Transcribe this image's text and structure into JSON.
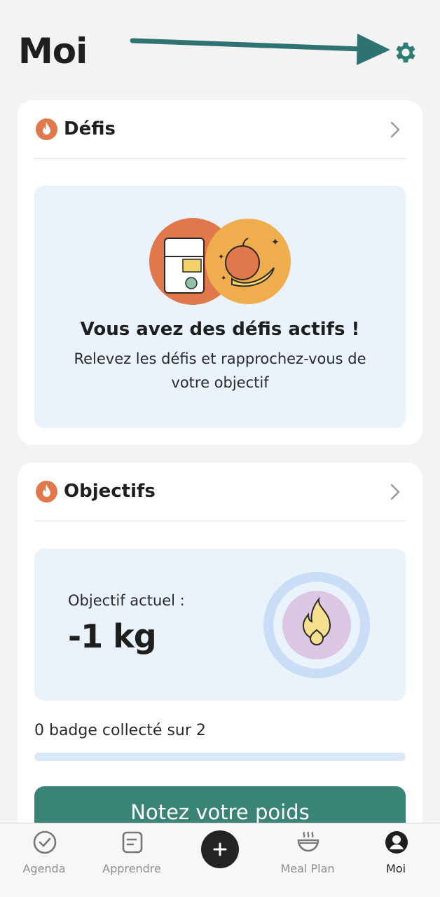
{
  "page": {
    "title": "Moi"
  },
  "icons": {
    "settings": "gear-icon",
    "annotation": "arrow-pointer"
  },
  "colors": {
    "accent": "#3a8477",
    "flame": "#e0784b",
    "panel": "#eaf2fc",
    "arrow": "#2e7372"
  },
  "defis_card": {
    "title": "Défis",
    "panel_title": "Vous avez des défis actifs !",
    "panel_subtitle": "Relevez les défis et rapprochez-vous de votre objectif"
  },
  "objectifs_card": {
    "title": "Objectifs",
    "current_label": "Objectif actuel :",
    "current_value": "-1 kg",
    "badges_text": "0 badge collecté sur 2",
    "badges_collected": 0,
    "badges_total": 2,
    "cta_label": "Notez votre poids"
  },
  "tabbar": {
    "items": [
      {
        "label": "Agenda",
        "icon": "check-circle-icon",
        "active": false
      },
      {
        "label": "Apprendre",
        "icon": "document-icon",
        "active": false
      },
      {
        "label": "",
        "icon": "plus-icon",
        "active": false
      },
      {
        "label": "Meal Plan",
        "icon": "bowl-icon",
        "active": false
      },
      {
        "label": "Moi",
        "icon": "person-icon",
        "active": true
      }
    ]
  }
}
